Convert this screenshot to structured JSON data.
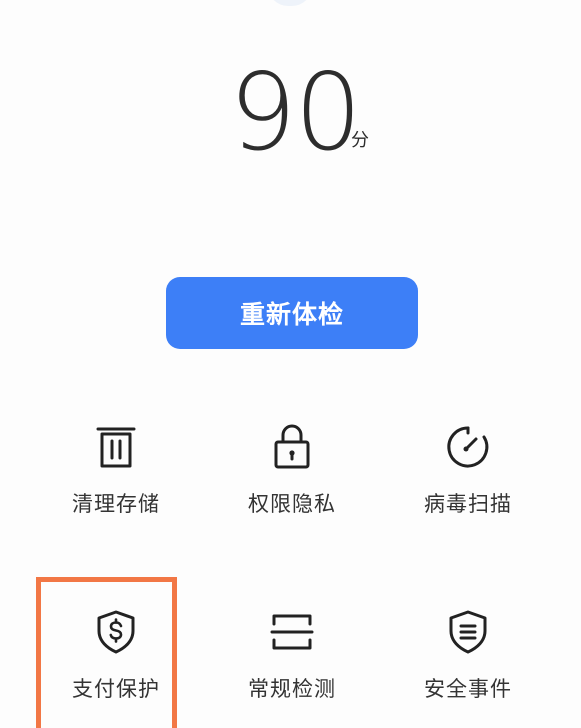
{
  "score": {
    "value": "90",
    "unit": "分"
  },
  "actions": {
    "recheck_label": "重新体检"
  },
  "features": [
    {
      "label": "清理存储",
      "icon": "trash-icon"
    },
    {
      "label": "权限隐私",
      "icon": "lock-icon"
    },
    {
      "label": "病毒扫描",
      "icon": "speedometer-icon"
    },
    {
      "label": "支付保护",
      "icon": "shield-dollar-icon"
    },
    {
      "label": "常规检测",
      "icon": "scan-frame-icon"
    },
    {
      "label": "安全事件",
      "icon": "shield-list-icon"
    }
  ],
  "colors": {
    "accent": "#3d7ff7",
    "highlight": "#f27745",
    "text": "#333333",
    "background": "#fdfdfd"
  }
}
